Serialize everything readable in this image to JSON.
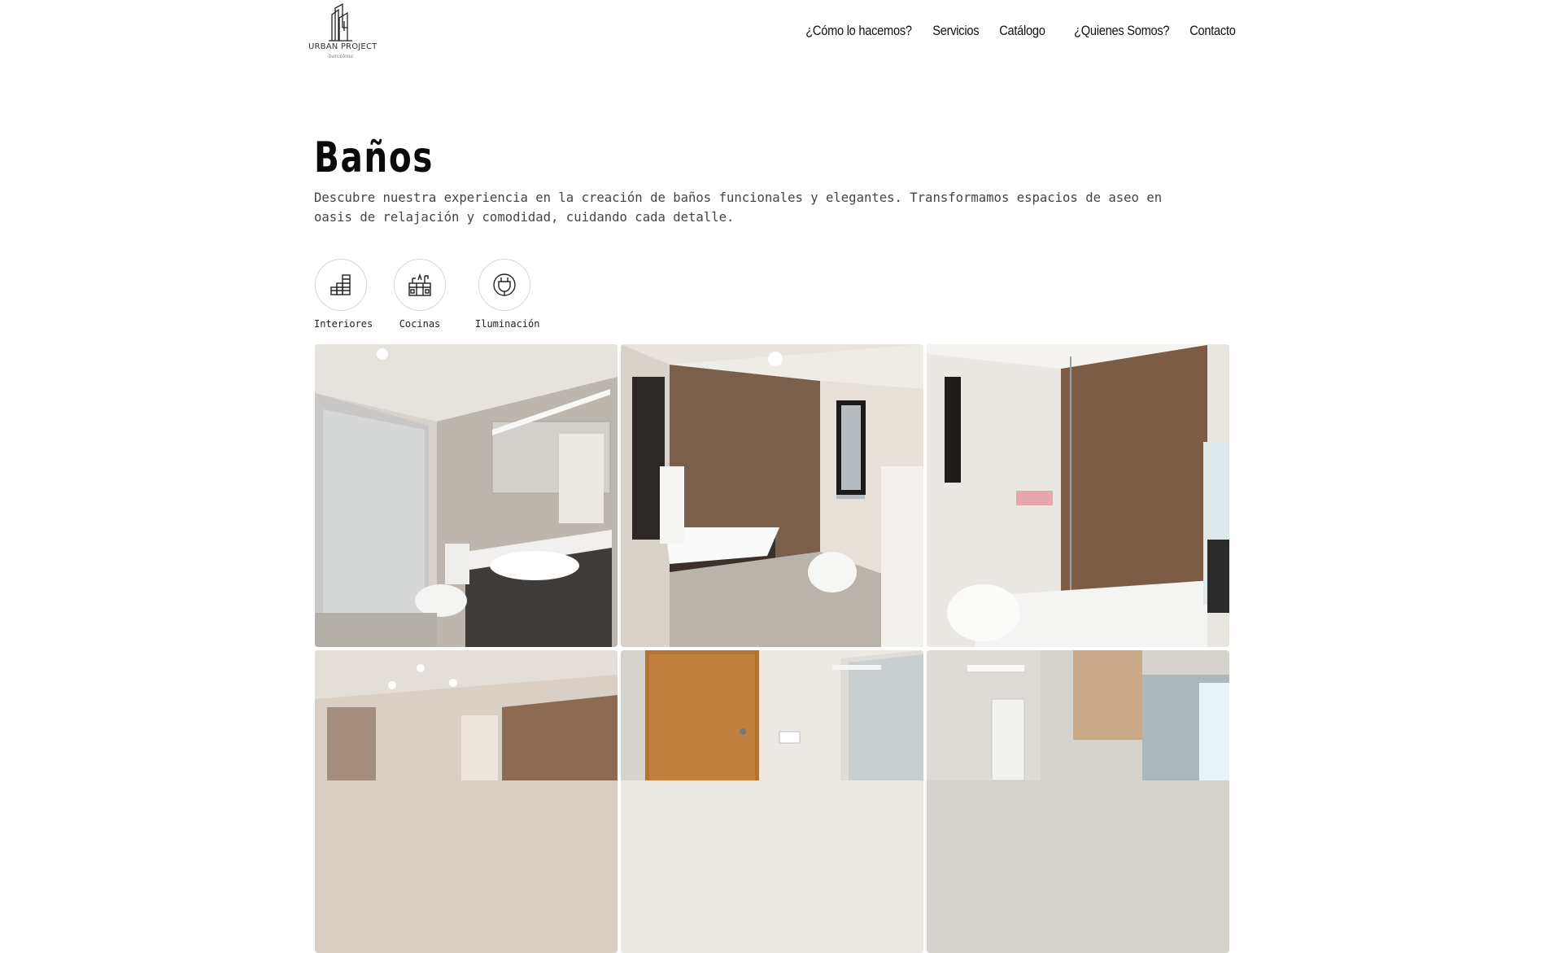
{
  "header": {
    "logo": {
      "name": "URBAN PROJECT",
      "sub": "barcelona"
    },
    "nav": [
      {
        "label": "¿Cómo lo hacemos?"
      },
      {
        "label": "Servicios"
      },
      {
        "label": "Catálogo"
      },
      {
        "label": "¿Quienes Somos?"
      },
      {
        "label": "Contacto"
      }
    ]
  },
  "hero": {
    "title": "Baños",
    "description": "Descubre nuestra experiencia en la creación de baños funcionales y elegantes. Transformamos espacios de aseo en oasis de relajación y comodidad, cuidando cada detalle."
  },
  "categories": [
    {
      "label": "Interiores",
      "icon": "interiors-icon"
    },
    {
      "label": "Cocinas",
      "icon": "kitchen-icon"
    },
    {
      "label": "Iluminación",
      "icon": "lighting-plug-icon"
    }
  ],
  "gallery": {
    "photos": [
      {
        "subject": "bathroom-photo-1"
      },
      {
        "subject": "bathroom-photo-2"
      },
      {
        "subject": "bathroom-photo-3"
      },
      {
        "subject": "bathroom-photo-4"
      },
      {
        "subject": "bathroom-photo-5"
      },
      {
        "subject": "bathroom-photo-6"
      }
    ]
  },
  "colors": {
    "text": "#111111",
    "muted": "#444444",
    "border": "#d6d6d6",
    "background": "#ffffff"
  }
}
